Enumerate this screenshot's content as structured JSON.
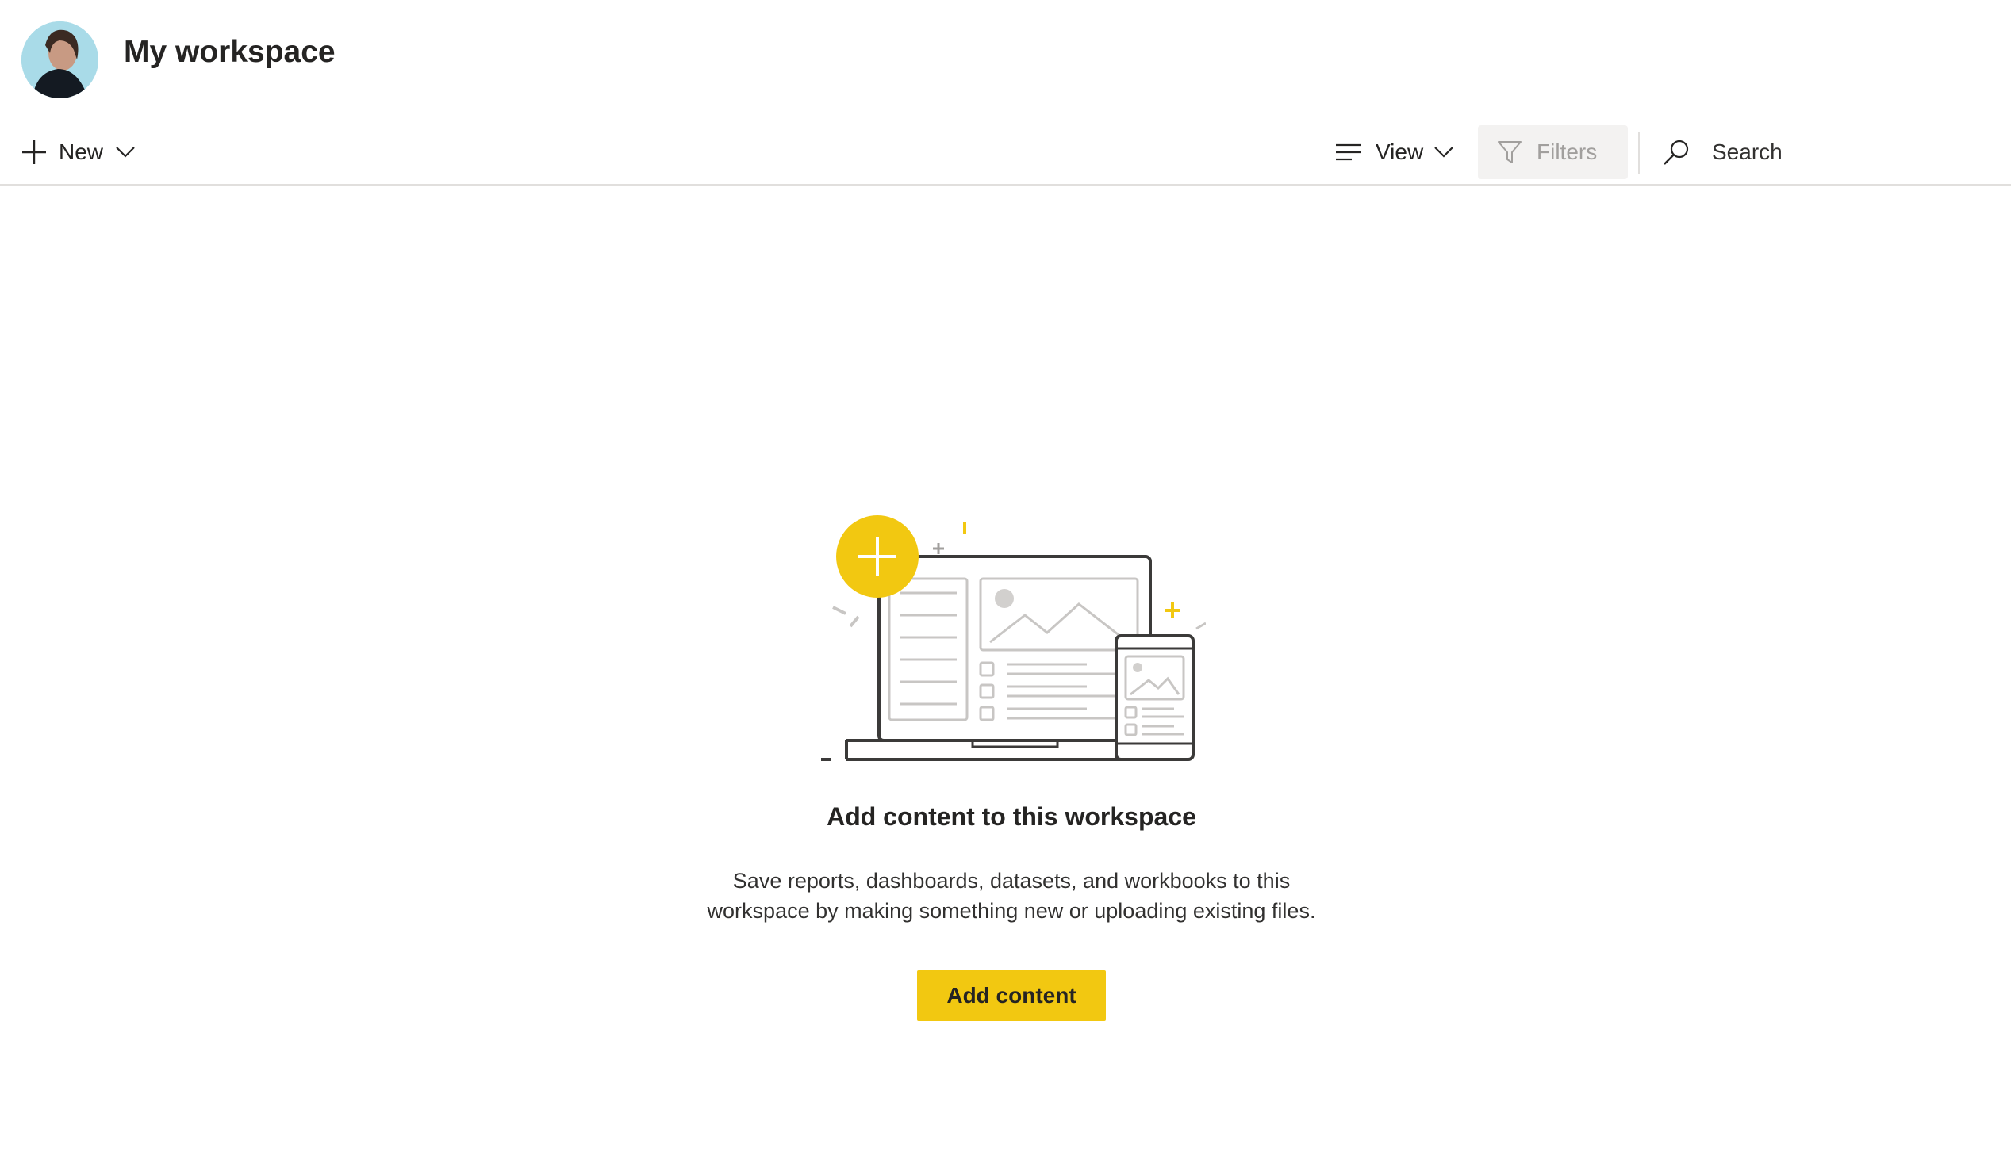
{
  "header": {
    "title": "My workspace",
    "avatar_icon": "user-avatar-photo"
  },
  "toolbar": {
    "new_label": "New",
    "view_label": "View",
    "filters_label": "Filters",
    "search_placeholder": "Search"
  },
  "empty_state": {
    "title": "Add content to this workspace",
    "description": "Save reports, dashboards, datasets, and workbooks to this workspace by making something new or uploading existing files.",
    "button_label": "Add content",
    "illustration": "laptop-and-phone-with-plus-icon"
  },
  "colors": {
    "accent": "#f2c811",
    "text": "#252423",
    "divider": "#e1dfdd",
    "filters_bg": "#f3f2f1",
    "filters_text": "#a19f9d"
  }
}
